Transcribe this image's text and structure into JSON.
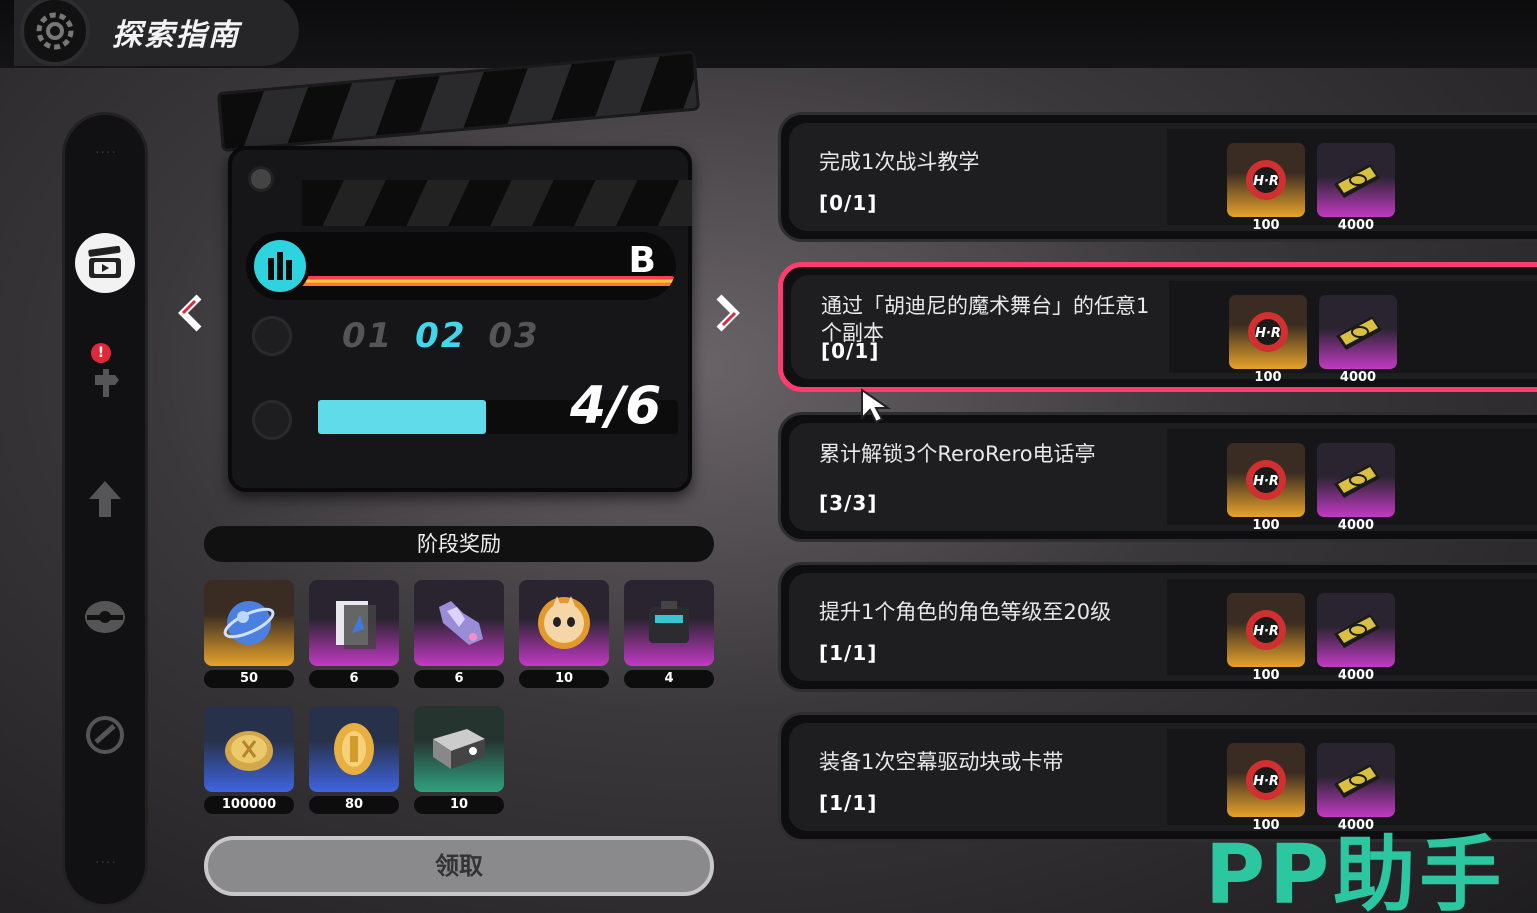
{
  "header": {
    "title": "探索指南",
    "logo_icon": "zone-gear-icon"
  },
  "sidebar": {
    "items": [
      {
        "name": "clapperboard",
        "icon": "clapperboard-icon",
        "active": true,
        "alert": false
      },
      {
        "name": "commission",
        "icon": "signpost-icon",
        "active": false,
        "alert": true,
        "alert_text": "!"
      },
      {
        "name": "upgrade",
        "icon": "arrow-up-icon",
        "active": false,
        "alert": false
      },
      {
        "name": "bangboo",
        "icon": "bangboo-icon",
        "active": false,
        "alert": false
      },
      {
        "name": "hollow",
        "icon": "hollow-icon",
        "active": false,
        "alert": false
      }
    ]
  },
  "clapper": {
    "grade": "B",
    "stages": [
      "01",
      "02",
      "03"
    ],
    "current_stage": "02",
    "progress_text": "4/6",
    "progress_value": 0.667
  },
  "stage_rewards": {
    "title": "阶段奖励",
    "items": [
      {
        "icon": "polychrome-orb-icon",
        "count": "50",
        "rarity": "gold"
      },
      {
        "icon": "skill-material-icon",
        "count": "6",
        "rarity": "purple"
      },
      {
        "icon": "crystal-cluster-icon",
        "count": "6",
        "rarity": "purple"
      },
      {
        "icon": "bangboo-token-icon",
        "count": "10",
        "rarity": "purple"
      },
      {
        "icon": "drive-box-icon",
        "count": "4",
        "rarity": "purple"
      },
      {
        "icon": "dennies-icon",
        "count": "100000",
        "rarity": "blue"
      },
      {
        "icon": "gold-coin-icon",
        "count": "80",
        "rarity": "blue"
      },
      {
        "icon": "tape-box-icon",
        "count": "10",
        "rarity": "teal"
      }
    ],
    "claim_label": "领取"
  },
  "missions": [
    {
      "desc": "完成1次战斗教学",
      "progress": "[0/1]",
      "selected": false,
      "rewards": [
        {
          "icon": "hunter-badge-icon",
          "count": "100"
        },
        {
          "icon": "tape-ticket-icon",
          "count": "4000"
        }
      ]
    },
    {
      "desc": "通过「胡迪尼的魔术舞台」的任意1个副本",
      "progress": "[0/1]",
      "selected": true,
      "rewards": [
        {
          "icon": "hunter-badge-icon",
          "count": "100"
        },
        {
          "icon": "tape-ticket-icon",
          "count": "4000"
        }
      ]
    },
    {
      "desc": "累计解锁3个ReroRero电话亭",
      "progress": "[3/3]",
      "selected": false,
      "rewards": [
        {
          "icon": "hunter-badge-icon",
          "count": "100"
        },
        {
          "icon": "tape-ticket-icon",
          "count": "4000"
        }
      ]
    },
    {
      "desc": "提升1个角色的角色等级至20级",
      "progress": "[1/1]",
      "selected": false,
      "rewards": [
        {
          "icon": "hunter-badge-icon",
          "count": "100"
        },
        {
          "icon": "tape-ticket-icon",
          "count": "4000"
        }
      ]
    },
    {
      "desc": "装备1次空幕驱动块或卡带",
      "progress": "[1/1]",
      "selected": false,
      "rewards": [
        {
          "icon": "hunter-badge-icon",
          "count": "100"
        },
        {
          "icon": "tape-ticket-icon",
          "count": "4000"
        }
      ]
    }
  ],
  "watermark": "PP助手",
  "colors": {
    "accent": "#ff3c6e",
    "progress": "#5fdbe9",
    "stage_current": "#41d6ec",
    "watermark": "#2cc6a0"
  }
}
